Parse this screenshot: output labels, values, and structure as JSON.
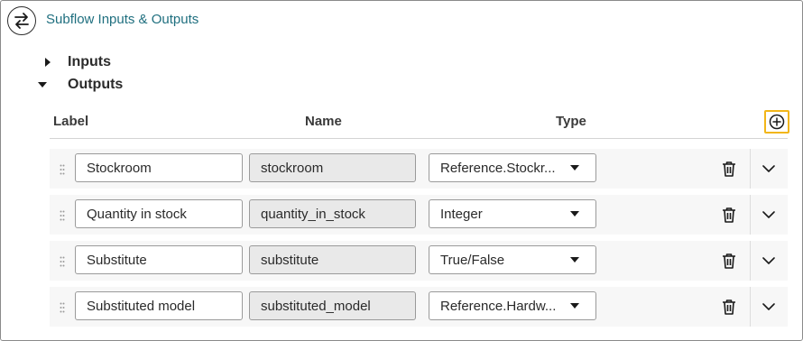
{
  "header": {
    "title": "Subflow Inputs & Outputs",
    "icon": "swap-arrows-icon"
  },
  "sections": {
    "inputs": {
      "label": "Inputs",
      "expanded": false
    },
    "outputs": {
      "label": "Outputs",
      "expanded": true
    }
  },
  "columns": {
    "label": "Label",
    "name": "Name",
    "type": "Type"
  },
  "accent_color": "#f2b619",
  "title_color": "#1f6f7f",
  "rows": [
    {
      "label": "Stockroom",
      "name": "stockroom",
      "type": "Reference.Stockr..."
    },
    {
      "label": "Quantity in stock",
      "name": "quantity_in_stock",
      "type": "Integer"
    },
    {
      "label": "Substitute",
      "name": "substitute",
      "type": "True/False"
    },
    {
      "label": "Substituted model",
      "name": "substituted_model",
      "type": "Reference.Hardw..."
    }
  ]
}
